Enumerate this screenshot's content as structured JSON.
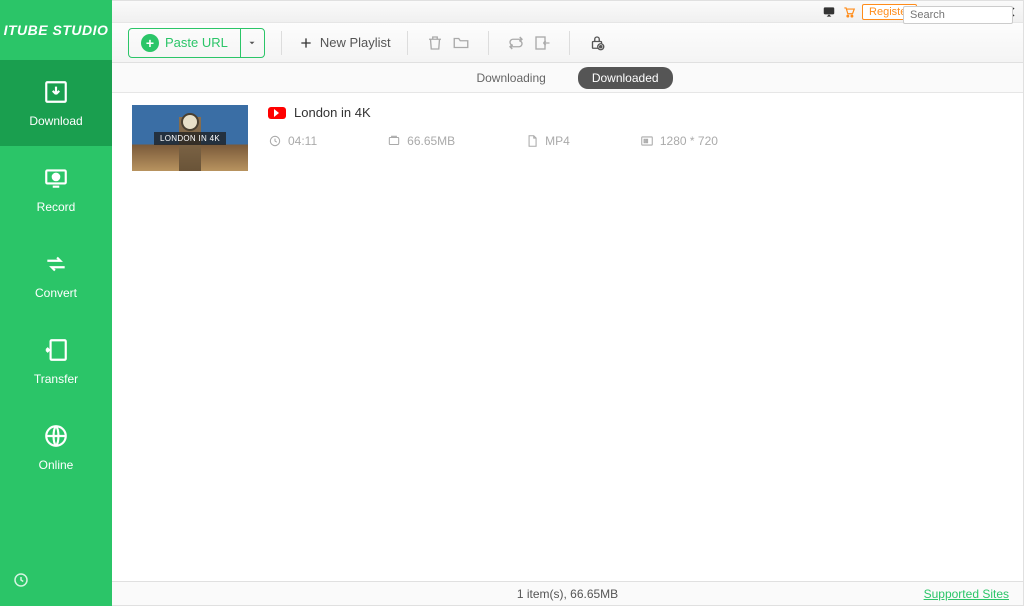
{
  "app_name": "ITUBE STUDIO",
  "titlebar": {
    "register_label": "Register"
  },
  "toolbar": {
    "paste_url_label": "Paste URL",
    "new_playlist_label": "New Playlist",
    "search_placeholder": "Search"
  },
  "sidebar": {
    "items": [
      {
        "label": "Download"
      },
      {
        "label": "Record"
      },
      {
        "label": "Convert"
      },
      {
        "label": "Transfer"
      },
      {
        "label": "Online"
      }
    ]
  },
  "tabs": {
    "downloading": "Downloading",
    "downloaded": "Downloaded"
  },
  "items": [
    {
      "title": "London in 4K",
      "thumb_text": "LONDON IN 4K",
      "duration": "04:11",
      "size": "66.65MB",
      "format": "MP4",
      "resolution": "1280 * 720"
    }
  ],
  "statusbar": {
    "summary": "1 item(s), 66.65MB",
    "supported_sites": "Supported Sites"
  }
}
